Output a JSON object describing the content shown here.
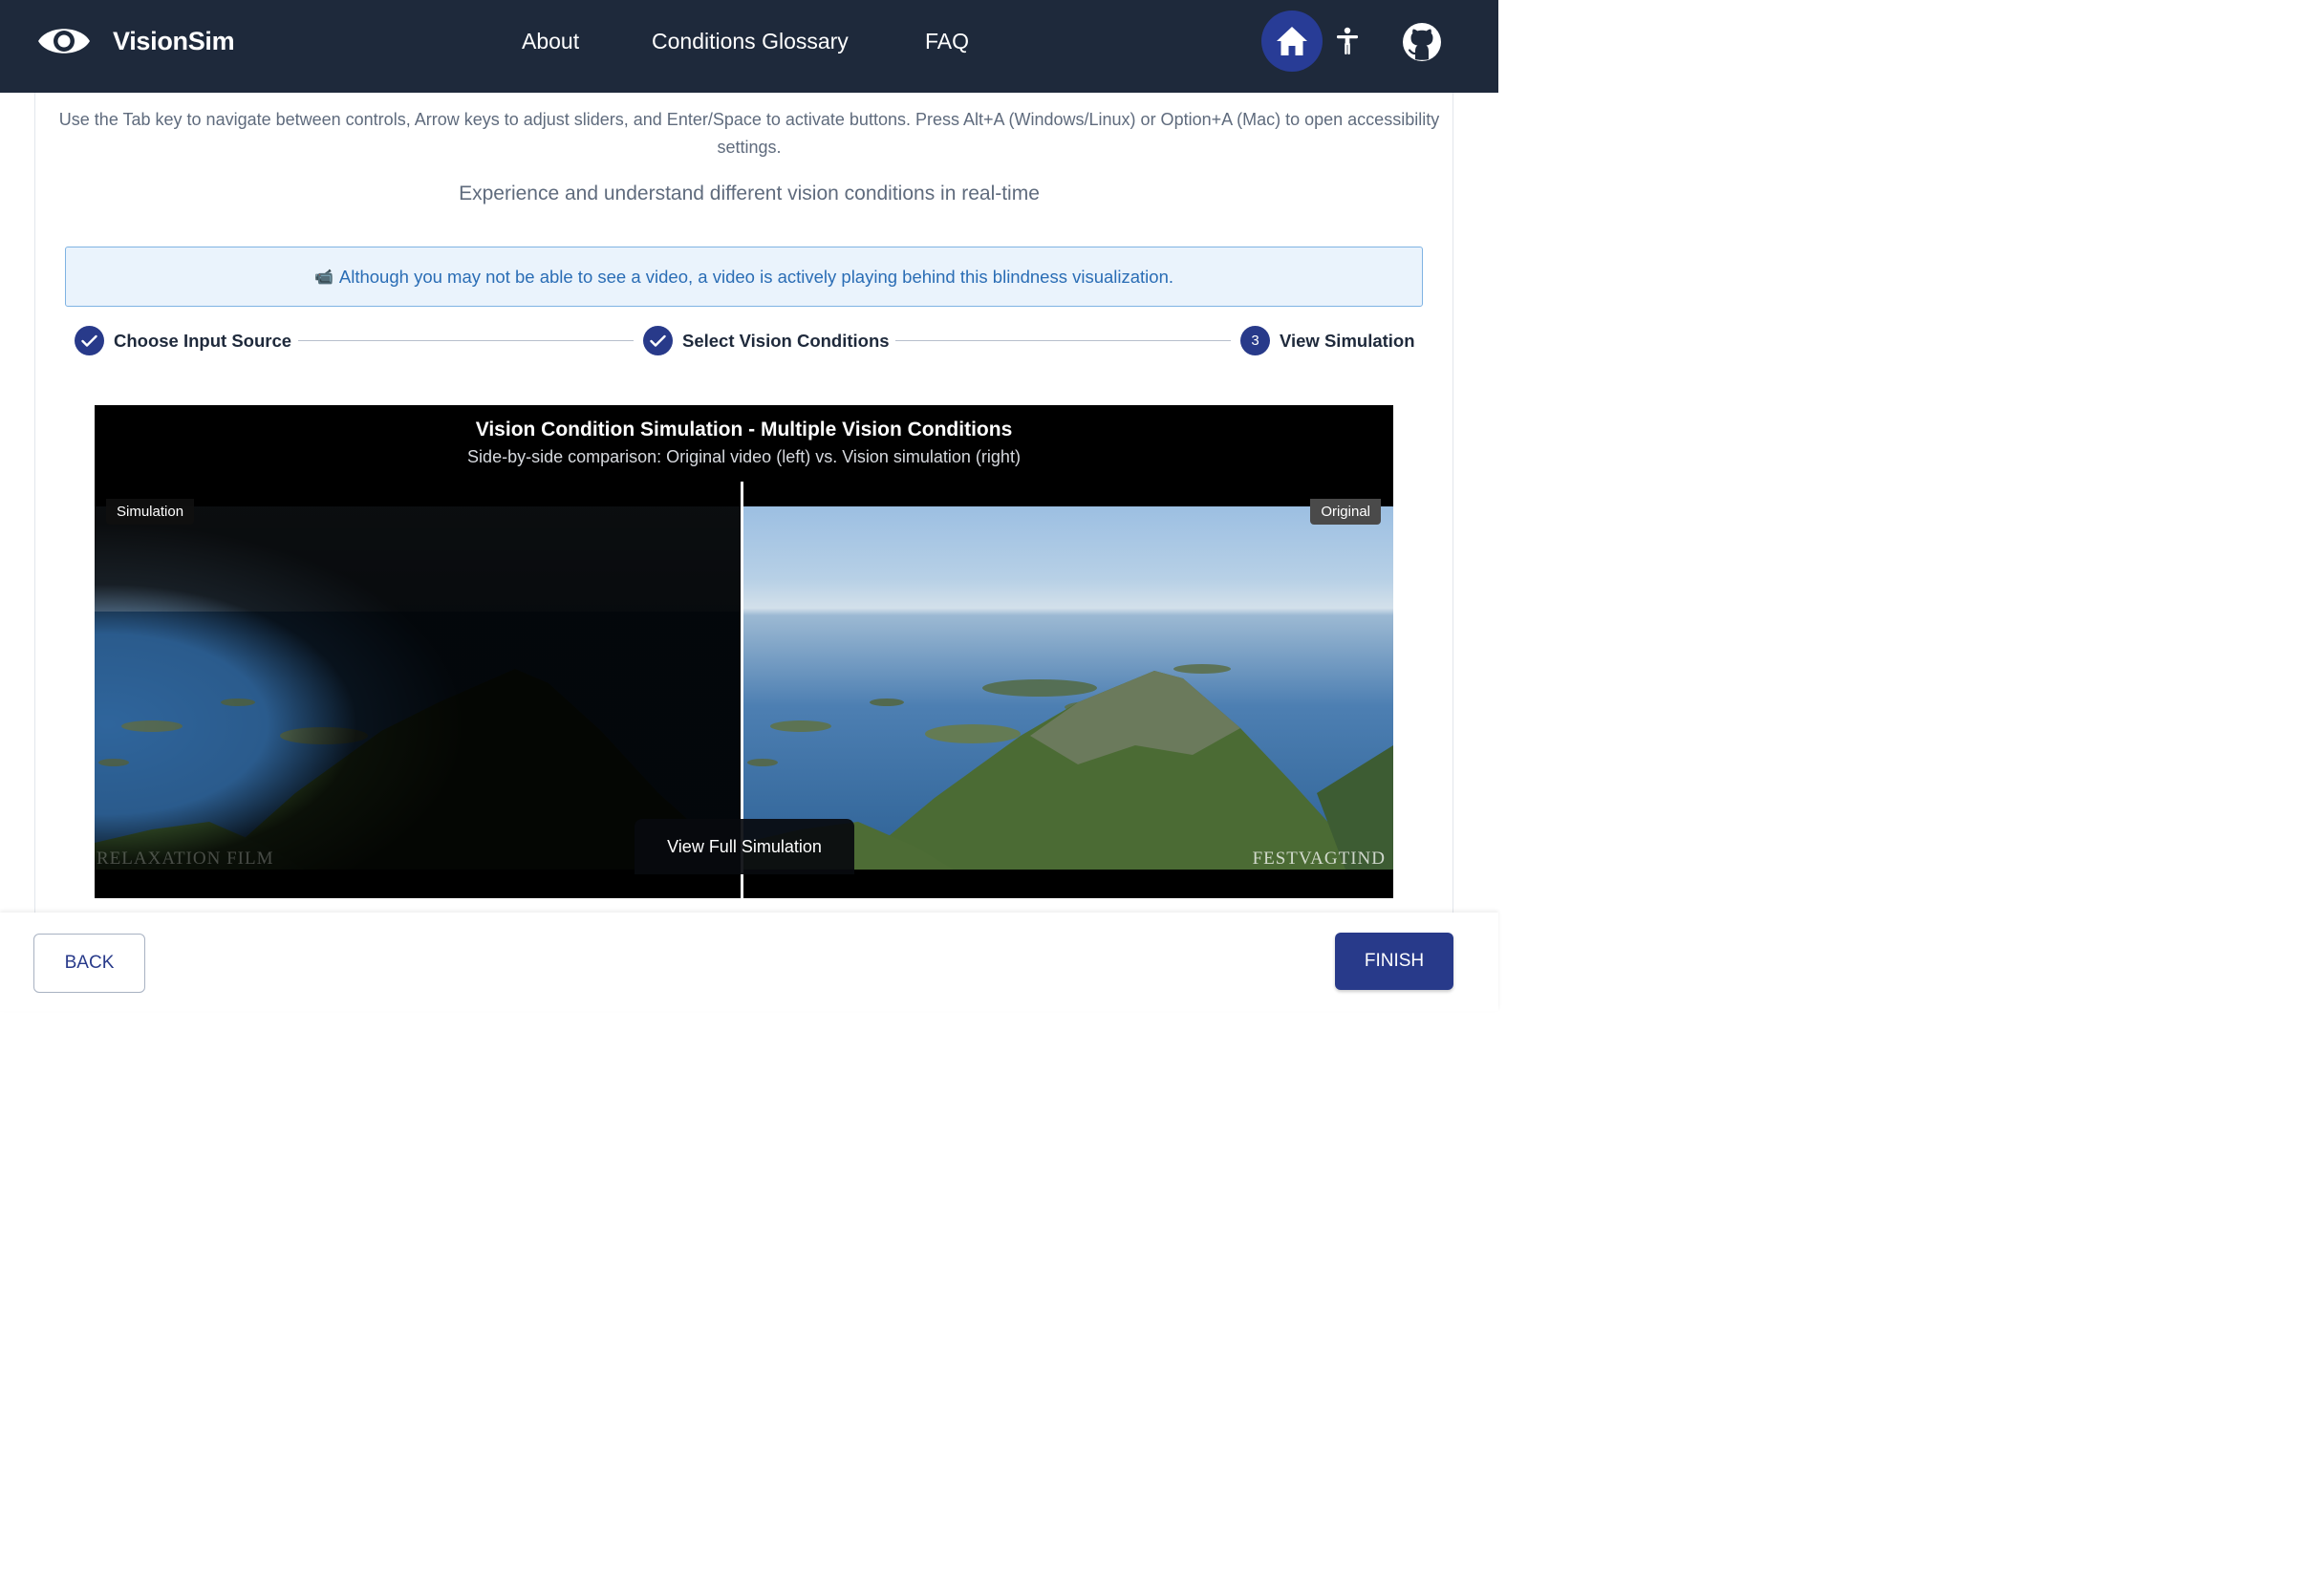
{
  "header": {
    "brand": "VisionSim",
    "nav": [
      "About",
      "Conditions Glossary",
      "FAQ"
    ],
    "icons": [
      "home-icon",
      "accessibility-icon",
      "github-icon"
    ]
  },
  "intro": {
    "keyboard_hint": "Use the Tab key to navigate between controls, Arrow keys to adjust sliders, and Enter/Space to activate buttons. Press Alt+A (Windows/Linux) or Option+A (Mac) to open accessibility settings.",
    "subtitle": "Experience and understand different vision conditions in real-time"
  },
  "notice": {
    "icon": "📹",
    "text": "Although you may not be able to see a video, a video is actively playing behind this blindness visualization."
  },
  "stepper": {
    "steps": [
      {
        "label": "Choose Input Source",
        "state": "complete"
      },
      {
        "label": "Select Vision Conditions",
        "state": "complete"
      },
      {
        "label": "View Simulation",
        "number": "3",
        "state": "active"
      }
    ]
  },
  "simulation": {
    "title": "Vision Condition Simulation - Multiple Vision Conditions",
    "subtitle": "Side-by-side comparison: Original video (left) vs. Vision simulation (right)",
    "left_tag": "Simulation",
    "right_tag": "Original",
    "view_full_label": "View Full Simulation",
    "watermark_left": "RELAXATION FILM",
    "watermark_right": "FESTVAGTIND"
  },
  "footer": {
    "back_label": "BACK",
    "finish_label": "FINISH"
  },
  "colors": {
    "header_bg": "#1e293b",
    "primary": "#283a8a",
    "home_bg": "#283c96",
    "notice_bg": "#eaf3fc",
    "notice_text": "#2a6db5"
  }
}
